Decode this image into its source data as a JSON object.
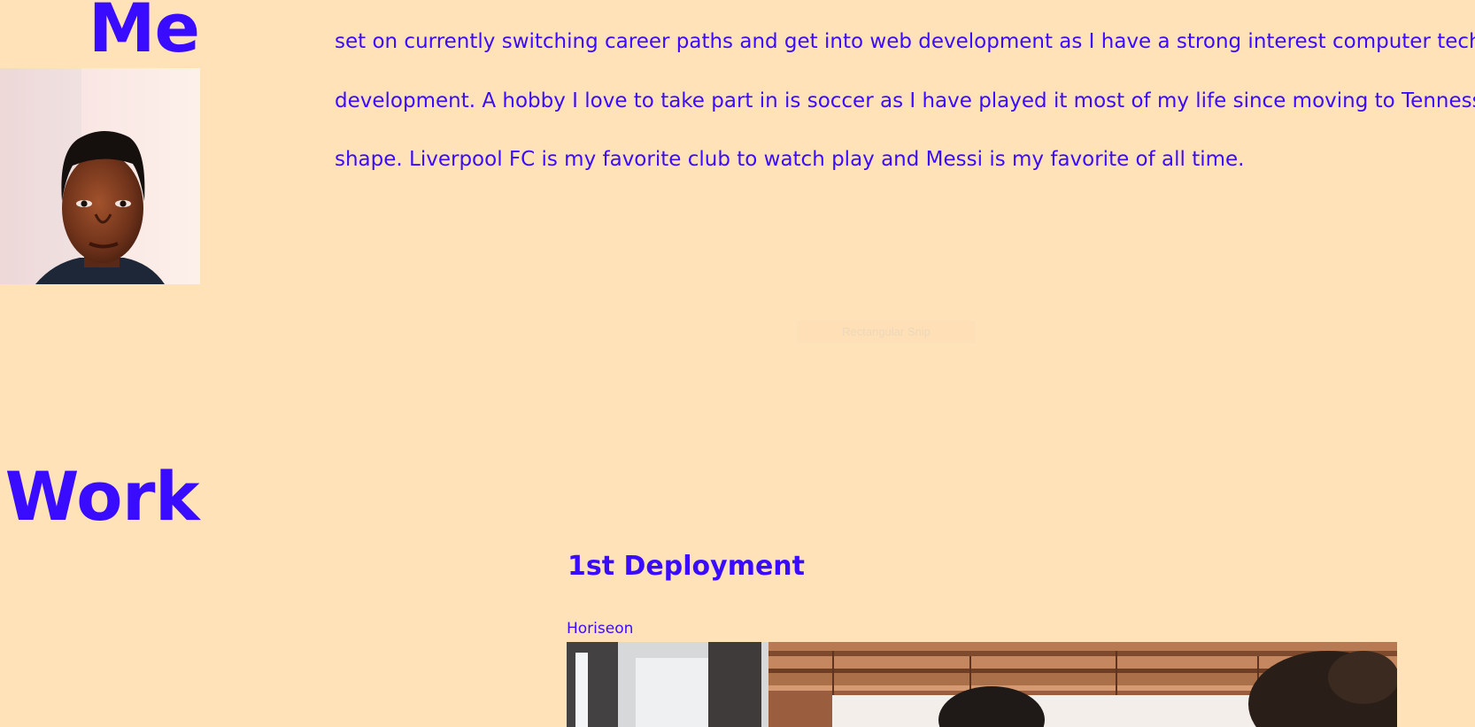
{
  "about": {
    "heading": "Me",
    "bio_lines": [
      "set on currently switching career paths and get into web development as I have a strong interest computer technology",
      "development. A hobby I love to take part in is soccer as I have played it most of my life since moving to Tennessee and",
      "shape. Liverpool FC is my favorite club to watch play and Messi is my favorite of all time."
    ]
  },
  "overlay": {
    "snip_label": "Rectangular Snip"
  },
  "work": {
    "heading": "Work",
    "project": {
      "title": "1st Deployment",
      "subtitle": "Horiseon"
    }
  },
  "colors": {
    "background": "#ffe2b8",
    "accent_text": "#3a0cff"
  }
}
